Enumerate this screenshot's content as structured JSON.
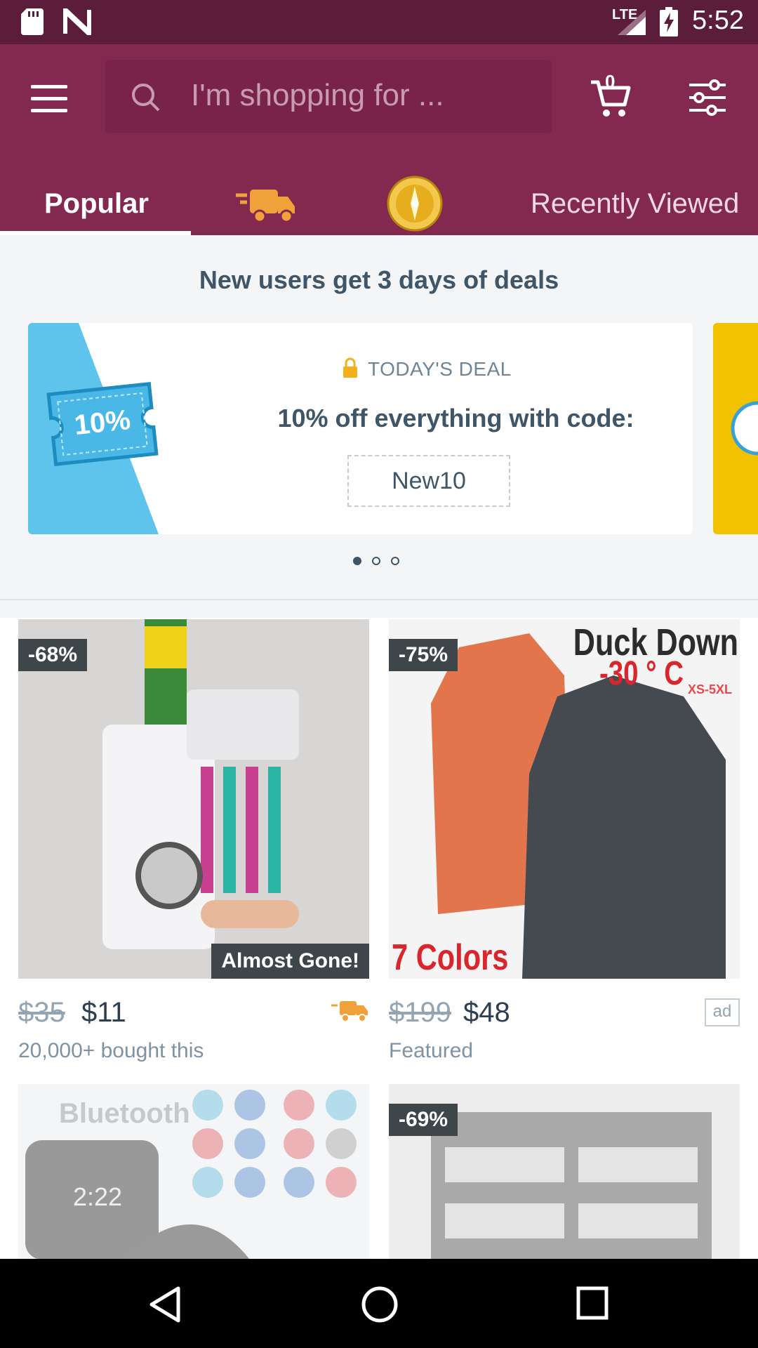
{
  "status_bar": {
    "time": "5:52",
    "network": "LTE",
    "icons": [
      "sd-card-icon",
      "n-icon",
      "signal-icon",
      "battery-charging-icon"
    ]
  },
  "search": {
    "placeholder": "I'm shopping for ..."
  },
  "cart": {
    "count": "0"
  },
  "tabs": [
    {
      "label": "Popular",
      "selected": true
    },
    {
      "icon": "fast-shipping-truck-icon"
    },
    {
      "icon": "gold-coin-icon"
    },
    {
      "label": "Recently Viewed"
    }
  ],
  "promo": {
    "header": "New users get 3 days of deals",
    "card": {
      "ticket_text": "10%",
      "title": "TODAY'S DEAL",
      "text": "10% off everything with code:",
      "code": "New10"
    },
    "carousel_pages": 3,
    "carousel_active": 0
  },
  "products": [
    {
      "discount": "-68%",
      "tag": "Almost Gone!",
      "old_price": "$35",
      "price": "$11",
      "subtitle": "20,000+ bought this",
      "shipping_icon": "fast-shipping-truck-icon"
    },
    {
      "discount": "-75%",
      "image_text": "Duck Down",
      "image_text2": "-30 ° C",
      "image_text3": "XS-5XL",
      "image_text4": "7 Colors",
      "old_price": "$199",
      "price": "$48",
      "subtitle": "Featured",
      "ad": "ad"
    },
    {
      "image_text": "Bluetooth",
      "image_time": "2:22"
    },
    {
      "discount": "-69%"
    }
  ],
  "colors": {
    "brand": "#83294f",
    "status_bar": "#5c1d3b",
    "accent_orange": "#f0a13a",
    "text_dark": "#3f5568"
  }
}
